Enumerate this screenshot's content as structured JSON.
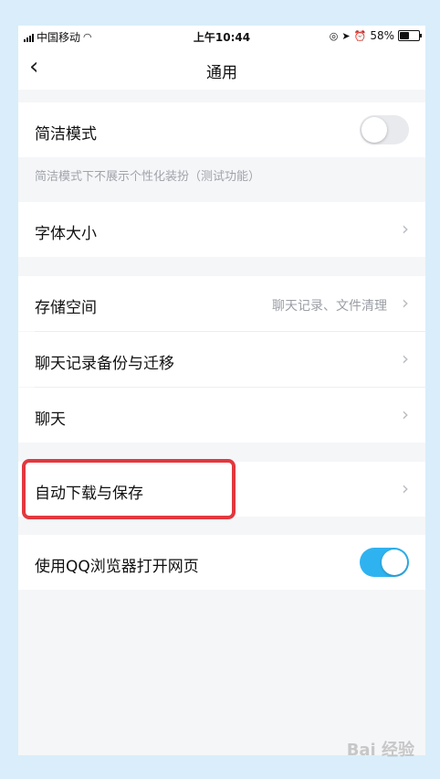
{
  "status_bar": {
    "carrier": "中国移动",
    "time": "上午10:44",
    "battery_text": "58%",
    "battery_level": 0.58
  },
  "nav": {
    "title": "通用",
    "back_icon": "chevron-left-icon"
  },
  "settings": {
    "simple_mode": {
      "label": "简洁模式",
      "enabled": false
    },
    "simple_mode_hint": "简洁模式下不展示个性化装扮（测试功能）",
    "font_size": {
      "label": "字体大小"
    },
    "storage": {
      "label": "存储空间",
      "detail": "聊天记录、文件清理"
    },
    "chat_backup": {
      "label": "聊天记录备份与迁移"
    },
    "chat": {
      "label": "聊天"
    },
    "auto_download": {
      "label": "自动下载与保存"
    },
    "qq_browser": {
      "label": "使用QQ浏览器打开网页",
      "enabled": true
    }
  },
  "watermark": "Bai 经验",
  "colors": {
    "accent": "#2fb3f0",
    "highlight": "#e2383f",
    "background": "#f5f6f8"
  }
}
